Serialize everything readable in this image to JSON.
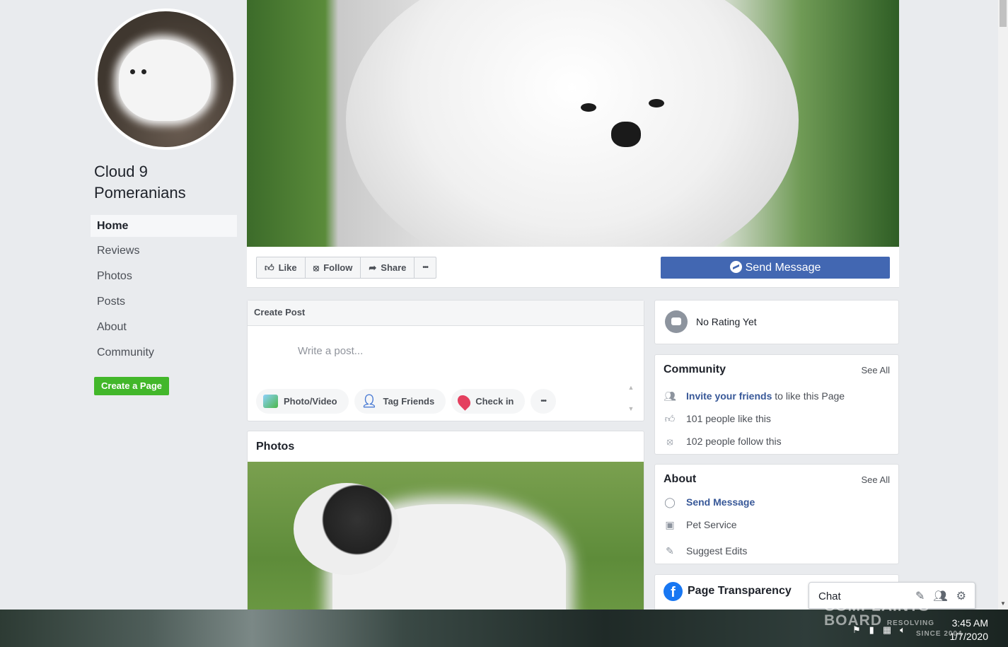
{
  "page": {
    "name": "Cloud 9 Pomeranians"
  },
  "nav": {
    "items": [
      {
        "label": "Home"
      },
      {
        "label": "Reviews"
      },
      {
        "label": "Photos"
      },
      {
        "label": "Posts"
      },
      {
        "label": "About"
      },
      {
        "label": "Community"
      }
    ],
    "create_page": "Create a Page"
  },
  "actions": {
    "like": "Like",
    "follow": "Follow",
    "share": "Share",
    "more": "•••",
    "send_message": "Send Message"
  },
  "create_post": {
    "title": "Create Post",
    "placeholder": "Write a post...",
    "photo_video": "Photo/Video",
    "tag_friends": "Tag Friends",
    "check_in": "Check in",
    "more": "•••"
  },
  "photos": {
    "title": "Photos"
  },
  "rating": {
    "text": "No Rating Yet"
  },
  "community": {
    "title": "Community",
    "see_all": "See All",
    "invite_link": "Invite your friends",
    "invite_rest": " to like this Page",
    "likes": "101 people like this",
    "follows": "102 people follow this"
  },
  "about": {
    "title": "About",
    "see_all": "See All",
    "send_message": "Send Message",
    "category": "Pet Service",
    "suggest": "Suggest Edits"
  },
  "transparency": {
    "title": "Page Transparency"
  },
  "chat": {
    "title": "Chat"
  },
  "taskbar": {
    "time": "3:45 AM",
    "date": "1/7/2020"
  },
  "watermark": {
    "line1": "COMPLAINTS",
    "line2": "BOARD",
    "small1": "RESOLVING",
    "small2": "SINCE 2004"
  },
  "colors": {
    "brand_blue": "#4267b2",
    "link_blue": "#385898",
    "create_green": "#42b72a",
    "page_bg": "#e9ebee"
  }
}
